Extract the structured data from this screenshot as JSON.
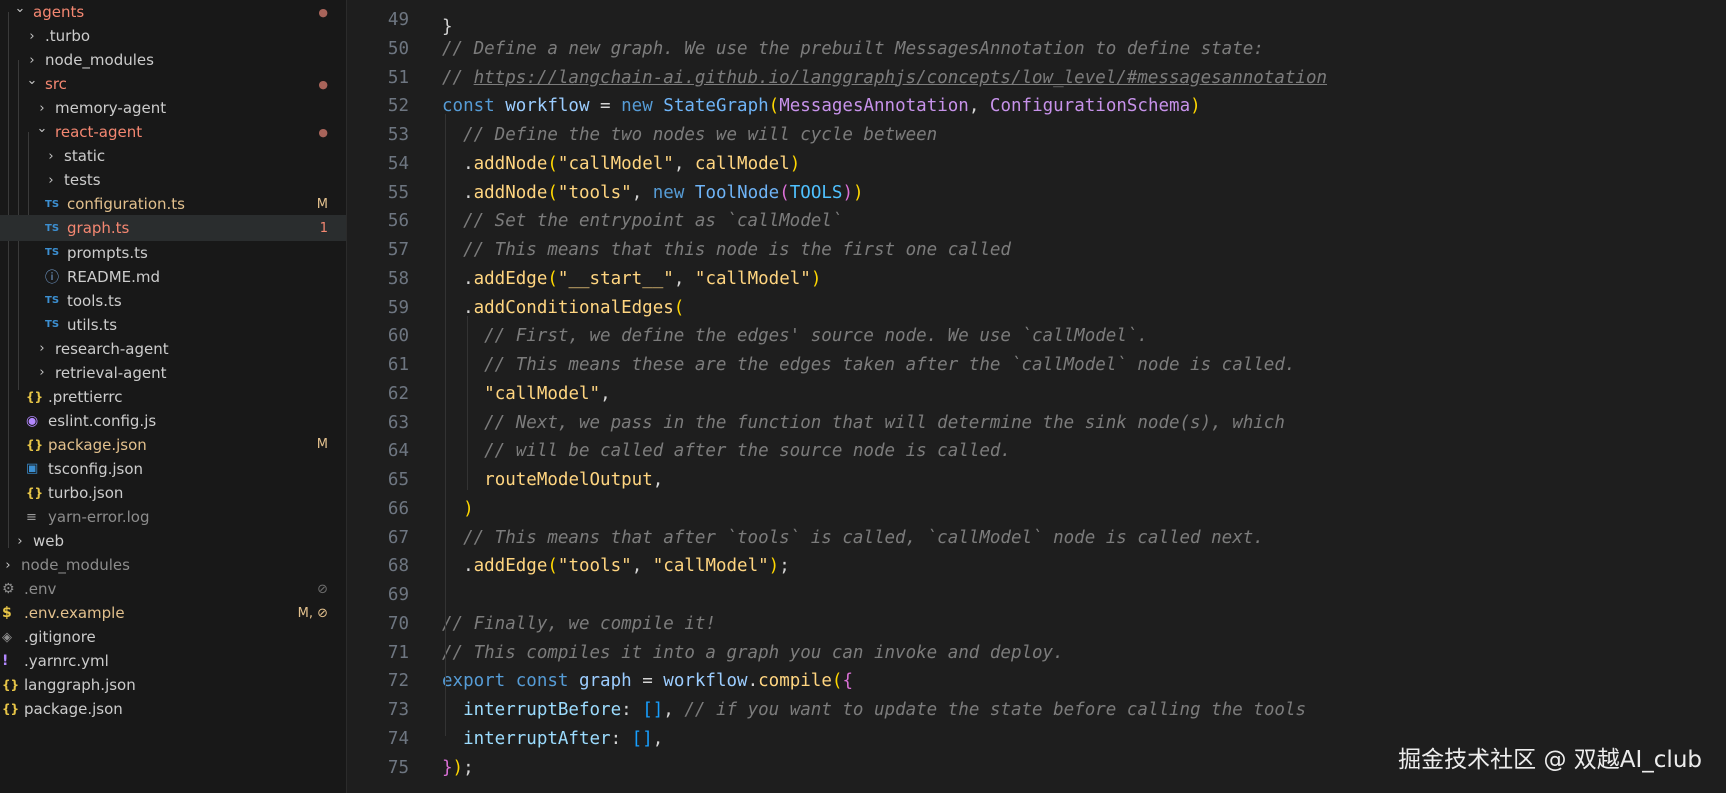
{
  "explorer": {
    "items": [
      {
        "label": "agents",
        "chevron": "down",
        "icon": "",
        "color": "red",
        "badge": "●",
        "badgeColor": "dot"
      },
      {
        "label": ".turbo",
        "chevron": "right",
        "icon": "",
        "color": "",
        "badge": "",
        "badgeColor": ""
      },
      {
        "label": "node_modules",
        "chevron": "right",
        "icon": "",
        "color": "",
        "badge": "",
        "badgeColor": ""
      },
      {
        "label": "src",
        "chevron": "down",
        "icon": "",
        "color": "red",
        "badge": "●",
        "badgeColor": "dot"
      },
      {
        "label": "memory-agent",
        "chevron": "right",
        "icon": "",
        "color": "",
        "badge": "",
        "badgeColor": ""
      },
      {
        "label": "react-agent",
        "chevron": "down",
        "icon": "",
        "color": "red",
        "badge": "●",
        "badgeColor": "dot"
      },
      {
        "label": "static",
        "chevron": "right",
        "icon": "",
        "color": "",
        "badge": "",
        "badgeColor": ""
      },
      {
        "label": "tests",
        "chevron": "right",
        "icon": "",
        "color": "",
        "badge": "",
        "badgeColor": ""
      },
      {
        "label": "configuration.ts",
        "chevron": "",
        "icon": "TS",
        "color": "yellow",
        "badge": "M",
        "badgeColor": "yellow"
      },
      {
        "label": "graph.ts",
        "chevron": "",
        "icon": "TS",
        "color": "red",
        "badge": "1",
        "badgeColor": "red"
      },
      {
        "label": "prompts.ts",
        "chevron": "",
        "icon": "TS",
        "color": "",
        "badge": "",
        "badgeColor": ""
      },
      {
        "label": "README.md",
        "chevron": "",
        "icon": "ⓘ",
        "color": "",
        "badge": "",
        "badgeColor": ""
      },
      {
        "label": "tools.ts",
        "chevron": "",
        "icon": "TS",
        "color": "",
        "badge": "",
        "badgeColor": ""
      },
      {
        "label": "utils.ts",
        "chevron": "",
        "icon": "TS",
        "color": "",
        "badge": "",
        "badgeColor": ""
      },
      {
        "label": "research-agent",
        "chevron": "right",
        "icon": "",
        "color": "",
        "badge": "",
        "badgeColor": ""
      },
      {
        "label": "retrieval-agent",
        "chevron": "right",
        "icon": "",
        "color": "",
        "badge": "",
        "badgeColor": ""
      },
      {
        "label": ".prettierrc",
        "chevron": "",
        "icon": "{}",
        "color": "",
        "badge": "",
        "badgeColor": ""
      },
      {
        "label": "eslint.config.js",
        "chevron": "",
        "icon": "◉",
        "color": "",
        "badge": "",
        "badgeColor": ""
      },
      {
        "label": "package.json",
        "chevron": "",
        "icon": "{}",
        "color": "yellow",
        "badge": "M",
        "badgeColor": "yellow"
      },
      {
        "label": "tsconfig.json",
        "chevron": "",
        "icon": "▣",
        "color": "",
        "badge": "",
        "badgeColor": ""
      },
      {
        "label": "turbo.json",
        "chevron": "",
        "icon": "{}",
        "color": "",
        "badge": "",
        "badgeColor": ""
      },
      {
        "label": "yarn-error.log",
        "chevron": "",
        "icon": "≡",
        "color": "dim",
        "badge": "",
        "badgeColor": ""
      },
      {
        "label": "web",
        "chevron": "right",
        "icon": "",
        "color": "",
        "badge": "",
        "badgeColor": ""
      },
      {
        "label": "node_modules",
        "chevron": "right",
        "icon": "",
        "color": "dim",
        "badge": "",
        "badgeColor": ""
      },
      {
        "label": ".env",
        "chevron": "",
        "icon": "⚙",
        "color": "dim",
        "badge": "⊘",
        "badgeColor": "dim"
      },
      {
        "label": ".env.example",
        "chevron": "",
        "icon": "$",
        "color": "yellow",
        "badge": "M, ⊘",
        "badgeColor": "yellow"
      },
      {
        "label": ".gitignore",
        "chevron": "",
        "icon": "◈",
        "color": "",
        "badge": "",
        "badgeColor": ""
      },
      {
        "label": ".yarnrc.yml",
        "chevron": "",
        "icon": "!",
        "color": "",
        "badge": "",
        "badgeColor": ""
      },
      {
        "label": "langgraph.json",
        "chevron": "",
        "icon": "{}",
        "color": "",
        "badge": "",
        "badgeColor": ""
      },
      {
        "label": "package.json",
        "chevron": "",
        "icon": "{}",
        "color": "",
        "badge": "",
        "badgeColor": ""
      }
    ]
  },
  "editor": {
    "lines": [
      {
        "n": "49",
        "tokens": []
      },
      {
        "n": "50",
        "tokens": [
          {
            "t": "// Define a new graph. We use the prebuilt MessagesAnnotation to define state:",
            "c": "cm"
          }
        ]
      },
      {
        "n": "51",
        "tokens": [
          {
            "t": "// ",
            "c": "cm"
          },
          {
            "t": "https://langchain-ai.github.io/langgraphjs/concepts/low_level/#messagesannotation",
            "c": "cm-link"
          }
        ]
      },
      {
        "n": "52",
        "tokens": [
          {
            "t": "const ",
            "c": "kw"
          },
          {
            "t": "workflow",
            "c": "vr"
          },
          {
            "t": " = ",
            "c": "pl"
          },
          {
            "t": "new ",
            "c": "kw"
          },
          {
            "t": "StateGraph",
            "c": "cls"
          },
          {
            "t": "(",
            "c": "br1"
          },
          {
            "t": "MessagesAnnotation",
            "c": "typ"
          },
          {
            "t": ", ",
            "c": "pl"
          },
          {
            "t": "ConfigurationSchema",
            "c": "typ"
          },
          {
            "t": ")",
            "c": "br1"
          }
        ]
      },
      {
        "n": "53",
        "tokens": [
          {
            "t": "  // Define the two nodes we will cycle between",
            "c": "cm"
          }
        ]
      },
      {
        "n": "54",
        "tokens": [
          {
            "t": "  .",
            "c": "pl"
          },
          {
            "t": "addNode",
            "c": "fn"
          },
          {
            "t": "(",
            "c": "br1"
          },
          {
            "t": "\"callModel\"",
            "c": "str"
          },
          {
            "t": ", ",
            "c": "pl"
          },
          {
            "t": "callModel",
            "c": "fn"
          },
          {
            "t": ")",
            "c": "br1"
          }
        ]
      },
      {
        "n": "55",
        "tokens": [
          {
            "t": "  .",
            "c": "pl"
          },
          {
            "t": "addNode",
            "c": "fn"
          },
          {
            "t": "(",
            "c": "br1"
          },
          {
            "t": "\"tools\"",
            "c": "str"
          },
          {
            "t": ", ",
            "c": "pl"
          },
          {
            "t": "new ",
            "c": "kw"
          },
          {
            "t": "ToolNode",
            "c": "cls"
          },
          {
            "t": "(",
            "c": "br2"
          },
          {
            "t": "TOOLS",
            "c": "cst"
          },
          {
            "t": ")",
            "c": "br2"
          },
          {
            "t": ")",
            "c": "br1"
          }
        ]
      },
      {
        "n": "56",
        "tokens": [
          {
            "t": "  // Set the entrypoint as `callModel`",
            "c": "cm"
          }
        ]
      },
      {
        "n": "57",
        "tokens": [
          {
            "t": "  // This means that this node is the first one called",
            "c": "cm"
          }
        ]
      },
      {
        "n": "58",
        "tokens": [
          {
            "t": "  .",
            "c": "pl"
          },
          {
            "t": "addEdge",
            "c": "fn"
          },
          {
            "t": "(",
            "c": "br1"
          },
          {
            "t": "\"__start__\"",
            "c": "str"
          },
          {
            "t": ", ",
            "c": "pl"
          },
          {
            "t": "\"callModel\"",
            "c": "str"
          },
          {
            "t": ")",
            "c": "br1"
          }
        ]
      },
      {
        "n": "59",
        "tokens": [
          {
            "t": "  .",
            "c": "pl"
          },
          {
            "t": "addConditionalEdges",
            "c": "fn"
          },
          {
            "t": "(",
            "c": "br1"
          }
        ]
      },
      {
        "n": "60",
        "tokens": [
          {
            "t": "    // First, we define the edges' source node. We use `callModel`.",
            "c": "cm"
          }
        ]
      },
      {
        "n": "61",
        "tokens": [
          {
            "t": "    // This means these are the edges taken after the `callModel` node is called.",
            "c": "cm"
          }
        ]
      },
      {
        "n": "62",
        "tokens": [
          {
            "t": "    ",
            "c": "pl"
          },
          {
            "t": "\"callModel\"",
            "c": "str"
          },
          {
            "t": ",",
            "c": "pl"
          }
        ]
      },
      {
        "n": "63",
        "tokens": [
          {
            "t": "    // Next, we pass in the function that will determine the sink node(s), which",
            "c": "cm"
          }
        ]
      },
      {
        "n": "64",
        "tokens": [
          {
            "t": "    // will be called after the source node is called.",
            "c": "cm"
          }
        ]
      },
      {
        "n": "65",
        "tokens": [
          {
            "t": "    ",
            "c": "pl"
          },
          {
            "t": "routeModelOutput",
            "c": "fn"
          },
          {
            "t": ",",
            "c": "pl"
          }
        ]
      },
      {
        "n": "66",
        "tokens": [
          {
            "t": "  ",
            "c": "pl"
          },
          {
            "t": ")",
            "c": "br1"
          }
        ]
      },
      {
        "n": "67",
        "tokens": [
          {
            "t": "  // This means that after `tools` is called, `callModel` node is called next.",
            "c": "cm"
          }
        ]
      },
      {
        "n": "68",
        "tokens": [
          {
            "t": "  .",
            "c": "pl"
          },
          {
            "t": "addEdge",
            "c": "fn"
          },
          {
            "t": "(",
            "c": "br1"
          },
          {
            "t": "\"tools\"",
            "c": "str"
          },
          {
            "t": ", ",
            "c": "pl"
          },
          {
            "t": "\"callModel\"",
            "c": "str"
          },
          {
            "t": ")",
            "c": "br1"
          },
          {
            "t": ";",
            "c": "pl"
          }
        ]
      },
      {
        "n": "69",
        "tokens": []
      },
      {
        "n": "70",
        "tokens": [
          {
            "t": "// Finally, we compile it!",
            "c": "cm"
          }
        ]
      },
      {
        "n": "71",
        "tokens": [
          {
            "t": "// This compiles it into a graph you can invoke and deploy.",
            "c": "cm"
          }
        ]
      },
      {
        "n": "72",
        "tokens": [
          {
            "t": "export ",
            "c": "kw"
          },
          {
            "t": "const ",
            "c": "kw"
          },
          {
            "t": "graph",
            "c": "vr"
          },
          {
            "t": " = ",
            "c": "pl"
          },
          {
            "t": "workflow",
            "c": "vr"
          },
          {
            "t": ".",
            "c": "pl"
          },
          {
            "t": "compile",
            "c": "fn"
          },
          {
            "t": "(",
            "c": "br1"
          },
          {
            "t": "{",
            "c": "br2"
          }
        ]
      },
      {
        "n": "73",
        "tokens": [
          {
            "t": "  ",
            "c": "pl"
          },
          {
            "t": "interruptBefore",
            "c": "prop"
          },
          {
            "t": ": ",
            "c": "pl"
          },
          {
            "t": "[]",
            "c": "br3"
          },
          {
            "t": ", ",
            "c": "pl"
          },
          {
            "t": "// if you want to update the state before calling the tools",
            "c": "cm"
          }
        ]
      },
      {
        "n": "74",
        "tokens": [
          {
            "t": "  ",
            "c": "pl"
          },
          {
            "t": "interruptAfter",
            "c": "prop"
          },
          {
            "t": ": ",
            "c": "pl"
          },
          {
            "t": "[]",
            "c": "br3"
          },
          {
            "t": ",",
            "c": "pl"
          }
        ]
      },
      {
        "n": "75",
        "tokens": [
          {
            "t": "}",
            "c": "br2"
          },
          {
            "t": ")",
            "c": "br1"
          },
          {
            "t": ";",
            "c": "pl"
          }
        ]
      }
    ]
  },
  "watermark": "掘金技术社区 @ 双越AI_club"
}
